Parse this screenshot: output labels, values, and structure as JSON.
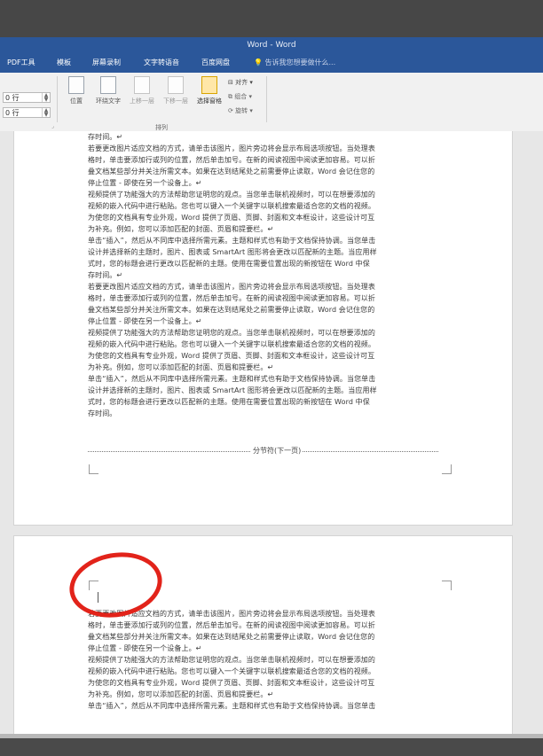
{
  "window": {
    "title": "Word - Word"
  },
  "menu": {
    "items": [
      "PDF工具",
      "模板",
      "屏幕录制",
      "文字转语音",
      "百度网盘"
    ],
    "tell_me": "告诉我您想要做什么..."
  },
  "ribbon": {
    "indent_before": "0 行",
    "indent_after": "0 行",
    "buttons": {
      "position": "位置",
      "wrap_text": "环绕文字",
      "bring_forward": "上移一层",
      "send_backward": "下移一层",
      "selection_pane": "选择窗格"
    },
    "small_buttons": {
      "align": "对齐",
      "group": "组合",
      "rotate": "旋转"
    },
    "group_label": "排列"
  },
  "document": {
    "page1_lines": [
      "存时间。↵",
      "若要更改图片适应文档的方式，请单击该图片，图片旁边将会显示布局选项按钮。当处理表",
      "格时，单击要添加行或列的位置，然后单击加号。在新的阅读视图中阅读更加容易。可以折",
      "叠文档某些部分并关注所需文本。如果在达到结尾处之前需要停止读取，Word 会记住您的",
      "停止位置 - 即使在另一个设备上。↵",
      "视频提供了功能强大的方法帮助您证明您的观点。当您单击联机视频时，可以在想要添加的",
      "视频的嵌入代码中进行粘贴。您也可以键入一个关键字以联机搜索最适合您的文档的视频。",
      "为使您的文档具有专业外观，Word 提供了页眉、页脚、封面和文本框设计，这些设计可互",
      "为补充。例如，您可以添加匹配的封面、页眉和提要栏。↵",
      "单击“插入”，然后从不同库中选择所需元素。主题和样式也有助于文档保持协调。当您单击",
      "设计并选择新的主题时，图片、图表或 SmartArt 图形将会更改以匹配新的主题。当应用样",
      "式时，您的标题会进行更改以匹配新的主题。使用在需要位置出现的新按钮在 Word 中保",
      "存时间。↵",
      "若要更改图片适应文档的方式，请单击该图片，图片旁边将会显示布局选项按钮。当处理表",
      "格时，单击要添加行或列的位置，然后单击加号。在新的阅读视图中阅读更加容易。可以折",
      "叠文档某些部分并关注所需文本。如果在达到结尾处之前需要停止读取，Word 会记住您的",
      "停止位置 - 即使在另一个设备上。↵",
      "视频提供了功能强大的方法帮助您证明您的观点。当您单击联机视频时，可以在想要添加的",
      "视频的嵌入代码中进行粘贴。您也可以键入一个关键字以联机搜索最适合您的文档的视频。",
      "为使您的文档具有专业外观，Word 提供了页眉、页脚、封面和文本框设计，这些设计可互",
      "为补充。例如，您可以添加匹配的封面、页眉和提要栏。↵",
      "单击“插入”，然后从不同库中选择所需元素。主题和样式也有助于文档保持协调。当您单击",
      "设计并选择新的主题时，图片、图表或 SmartArt 图形将会更改以匹配新的主题。当应用样",
      "式时，您的标题会进行更改以匹配新的主题。使用在需要位置出现的新按钮在 Word 中保",
      "存时间。"
    ],
    "section_break": "分节符(下一页)",
    "page2_lines": [
      "若要更改图片适应文档的方式，请单击该图片，图片旁边将会显示布局选项按钮。当处理表",
      "格时，单击要添加行或列的位置，然后单击加号。在新的阅读视图中阅读更加容易。可以折",
      "叠文档某些部分并关注所需文本。如果在达到结尾处之前需要停止读取，Word 会记住您的",
      "停止位置 - 即使在另一个设备上。↵",
      "视频提供了功能强大的方法帮助您证明您的观点。当您单击联机视频时，可以在想要添加的",
      "视频的嵌入代码中进行粘贴。您也可以键入一个关键字以联机搜索最适合您的文档的视频。",
      "为使您的文档具有专业外观，Word 提供了页眉、页脚、封面和文本框设计，这些设计可互",
      "为补充。例如，您可以添加匹配的封面、页眉和提要栏。↵",
      "单击“插入”，然后从不同库中选择所需元素。主题和样式也有助于文档保持协调。当您单击"
    ]
  },
  "colors": {
    "ribbon_blue": "#2b579a",
    "annotation_red": "#e2231a"
  }
}
